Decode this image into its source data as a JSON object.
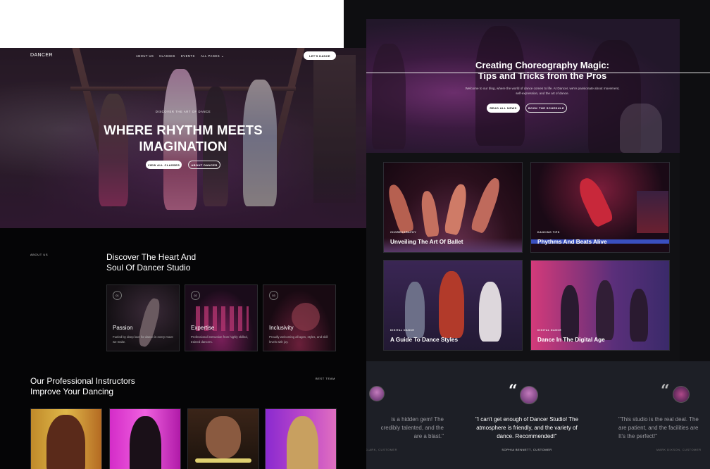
{
  "colors": {
    "background": "#050506",
    "accent": "#ffffff",
    "purple": "#6b2e6c",
    "magenta": "#d42cc8"
  },
  "nav": {
    "logo": "DANCER",
    "links": [
      "ABOUT US",
      "CLASSES",
      "EVENTS",
      "ALL PAGES"
    ],
    "dropdown_icon": "chevron-down-icon",
    "cta": "LET'S DANCE"
  },
  "hero": {
    "kicker": "DISCOVER THE ART OF DANCE",
    "title_line1": "WHERE RHYTHM MEETS",
    "title_line2": "IMAGINATION",
    "primary_button": "VIEW ALL CLASSES",
    "secondary_button": "ABOUT DANCER"
  },
  "about": {
    "label": "ABOUT US",
    "title_line1": "Discover The Heart And",
    "title_line2": "Soul Of Dancer Studio",
    "features": [
      {
        "num": "01",
        "title": "Passion",
        "desc": "Fueled by deep love for dance in every move we make."
      },
      {
        "num": "02",
        "title": "Expertise",
        "desc": "Professional instruction from highly skilled, trained dancers."
      },
      {
        "num": "03",
        "title": "Inclusivity",
        "desc": "Proudly welcoming all ages, styles, and skill levels with joy."
      }
    ]
  },
  "instructors": {
    "title_line1": "Our Professional Instructors",
    "title_line2": "Improve Your Dancing",
    "label": "BEST TEAM"
  },
  "blog": {
    "title_line1": "Creating Choreography Magic:",
    "title_line2": "Tips and Tricks from the Pros",
    "text": "Welcome to our blog, where the world of dance comes to life. At Dancer, we're passionate about movement, self-expression, and the art of dance.",
    "primary_button": "READ ALL NEWS",
    "secondary_button": "BOOK THE SCHEDULE",
    "posts": [
      {
        "category": "CHOREOGRAPHY",
        "title": "Unveiling The Art Of Ballet"
      },
      {
        "category": "DANCING TIPS",
        "title": "Phythms And Beats Alive"
      },
      {
        "category": "DIGITAL DANCE",
        "title": "A Guide To Dance Styles"
      },
      {
        "category": "DIGITAL DANCE",
        "title": "Dance In The Digital Age"
      }
    ]
  },
  "testimonials": [
    {
      "line1": "is a hidden gem! The",
      "line2": "credibly talented, and the",
      "line3": "are a blast.\"",
      "name": "CLARK, CUSTOMER"
    },
    {
      "line1": "\"I can't get enough of Dancer Studio! The",
      "line2": "atmosphere is friendly, and the variety of",
      "line3": "dance. Recommended!\"",
      "name": "SOPHIA BENNETT, CUSTOMER"
    },
    {
      "line1": "\"This studio is the real deal. The",
      "line2": "are patient, and the facilities are",
      "line3": "It's the perfect!\"",
      "name": "MARK DIXSON, CUSTOMER"
    }
  ]
}
